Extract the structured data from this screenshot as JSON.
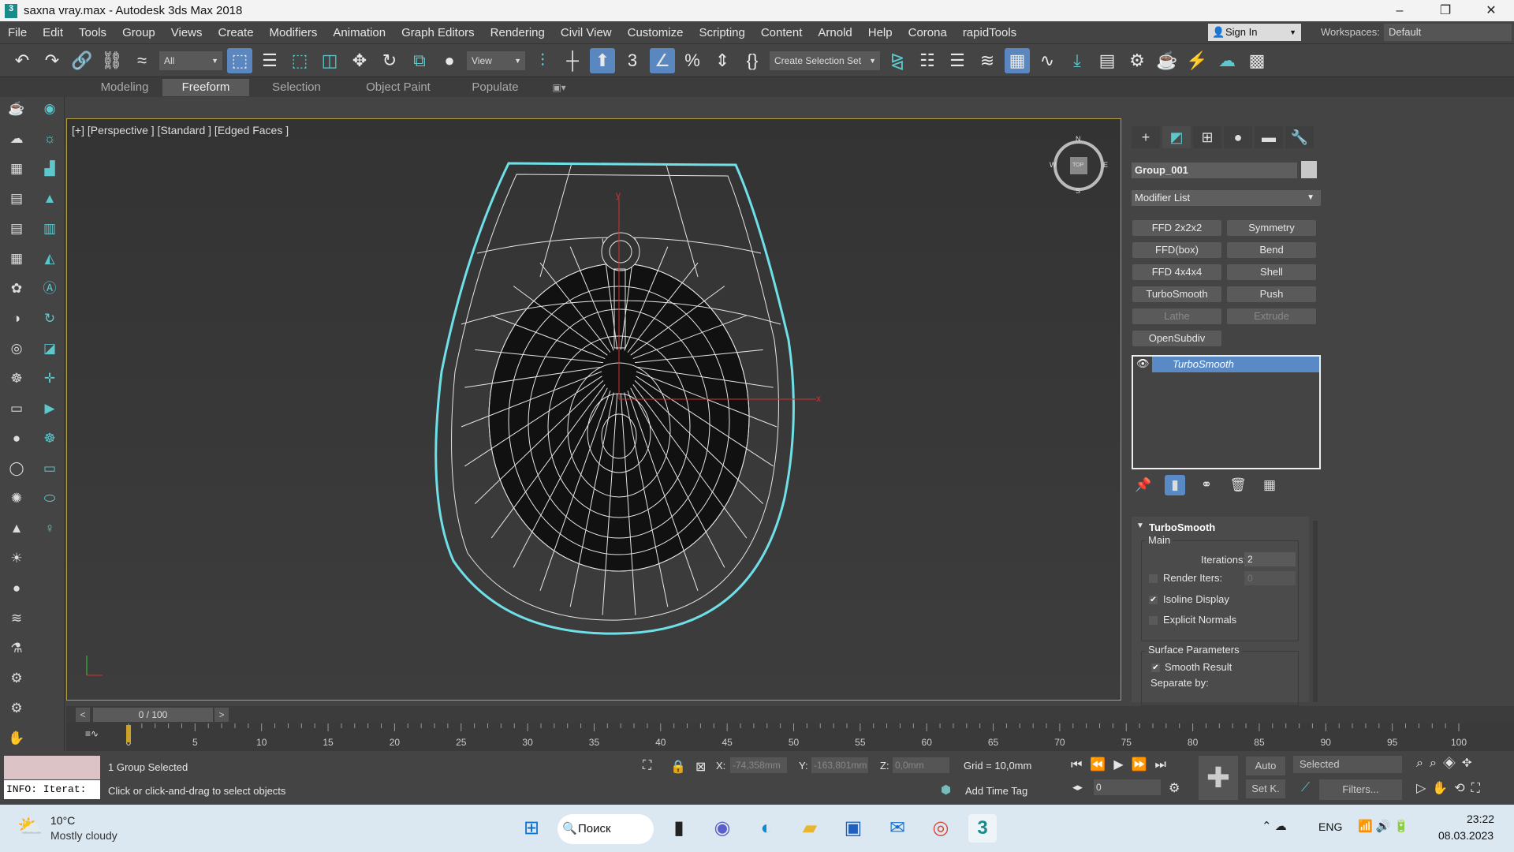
{
  "window": {
    "title": "saxna vray.max - Autodesk 3ds Max 2018",
    "app_icon": "3",
    "controls": [
      "–",
      "❐",
      "✕"
    ]
  },
  "menu": [
    "File",
    "Edit",
    "Tools",
    "Group",
    "Views",
    "Create",
    "Modifiers",
    "Animation",
    "Graph Editors",
    "Rendering",
    "Civil View",
    "Customize",
    "Scripting",
    "Content",
    "Arnold",
    "Help",
    "Corona",
    "rapidTools"
  ],
  "account": {
    "sign_in": "Sign In",
    "workspaces_label": "Workspaces:",
    "workspace": "Default"
  },
  "toolbar": {
    "filter": "All",
    "ref_coord": "View",
    "selection_set": "Create Selection Set"
  },
  "ribbon": {
    "tabs": [
      "Modeling",
      "Freeform",
      "Selection",
      "Object Paint",
      "Populate"
    ],
    "active": "Freeform"
  },
  "viewport": {
    "label": "[+] [Perspective ] [Standard ] [Edged Faces ]",
    "viewcube": {
      "n": "N",
      "s": "S",
      "w": "W",
      "e": "E",
      "face": "TOP"
    },
    "axis_x": "x",
    "axis_y": "y"
  },
  "panel": {
    "object_name": "Group_001",
    "modifier_list": "Modifier List",
    "modifier_buttons": [
      {
        "label": "FFD 2x2x2",
        "enabled": true
      },
      {
        "label": "Symmetry",
        "enabled": true
      },
      {
        "label": "FFD(box)",
        "enabled": true
      },
      {
        "label": "Bend",
        "enabled": true
      },
      {
        "label": "FFD 4x4x4",
        "enabled": true
      },
      {
        "label": "Shell",
        "enabled": true
      },
      {
        "label": "TurboSmooth",
        "enabled": true
      },
      {
        "label": "Push",
        "enabled": true
      },
      {
        "label": "Lathe",
        "enabled": false
      },
      {
        "label": "Extrude",
        "enabled": false
      },
      {
        "label": "OpenSubdiv",
        "enabled": true
      }
    ],
    "stack": [
      "TurboSmooth"
    ],
    "rollout": {
      "title": "TurboSmooth",
      "main": "Main",
      "iterations_label": "Iterations:",
      "iterations": "2",
      "render_iters_label": "Render Iters:",
      "render_iters": "0",
      "render_iters_checked": false,
      "isoline_label": "Isoline Display",
      "isoline_checked": true,
      "explicit_label": "Explicit Normals",
      "explicit_checked": false,
      "surface_label": "Surface Parameters",
      "smooth_label": "Smooth Result",
      "smooth_checked": true,
      "separate_label": "Separate by:"
    }
  },
  "timeline": {
    "position": "0 / 100",
    "current": 0,
    "end": 100,
    "ticks": [
      "0",
      "5",
      "10",
      "15",
      "20",
      "25",
      "30",
      "35",
      "40",
      "45",
      "50",
      "55",
      "60",
      "65",
      "70",
      "75",
      "80",
      "85",
      "90",
      "95",
      "100"
    ]
  },
  "status": {
    "maxscript": "INFO: Iterat:",
    "selected": "1 Group Selected",
    "prompt": "Click or click-and-drag to select objects",
    "x_label": "X:",
    "x": "-74,358mm",
    "y_label": "Y:",
    "y": "-163,801mm",
    "z_label": "Z:",
    "z": "0,0mm",
    "grid": "Grid = 10,0mm",
    "add_time_tag": "Add Time Tag",
    "frame": "0",
    "auto": "Auto",
    "setk": "Set K.",
    "key_filter": "Selected",
    "filters": "Filters..."
  },
  "taskbar": {
    "temp": "10°C",
    "weather": "Mostly cloudy",
    "search": "Поиск",
    "lang": "ENG",
    "time": "23:22",
    "date": "08.03.2023"
  }
}
